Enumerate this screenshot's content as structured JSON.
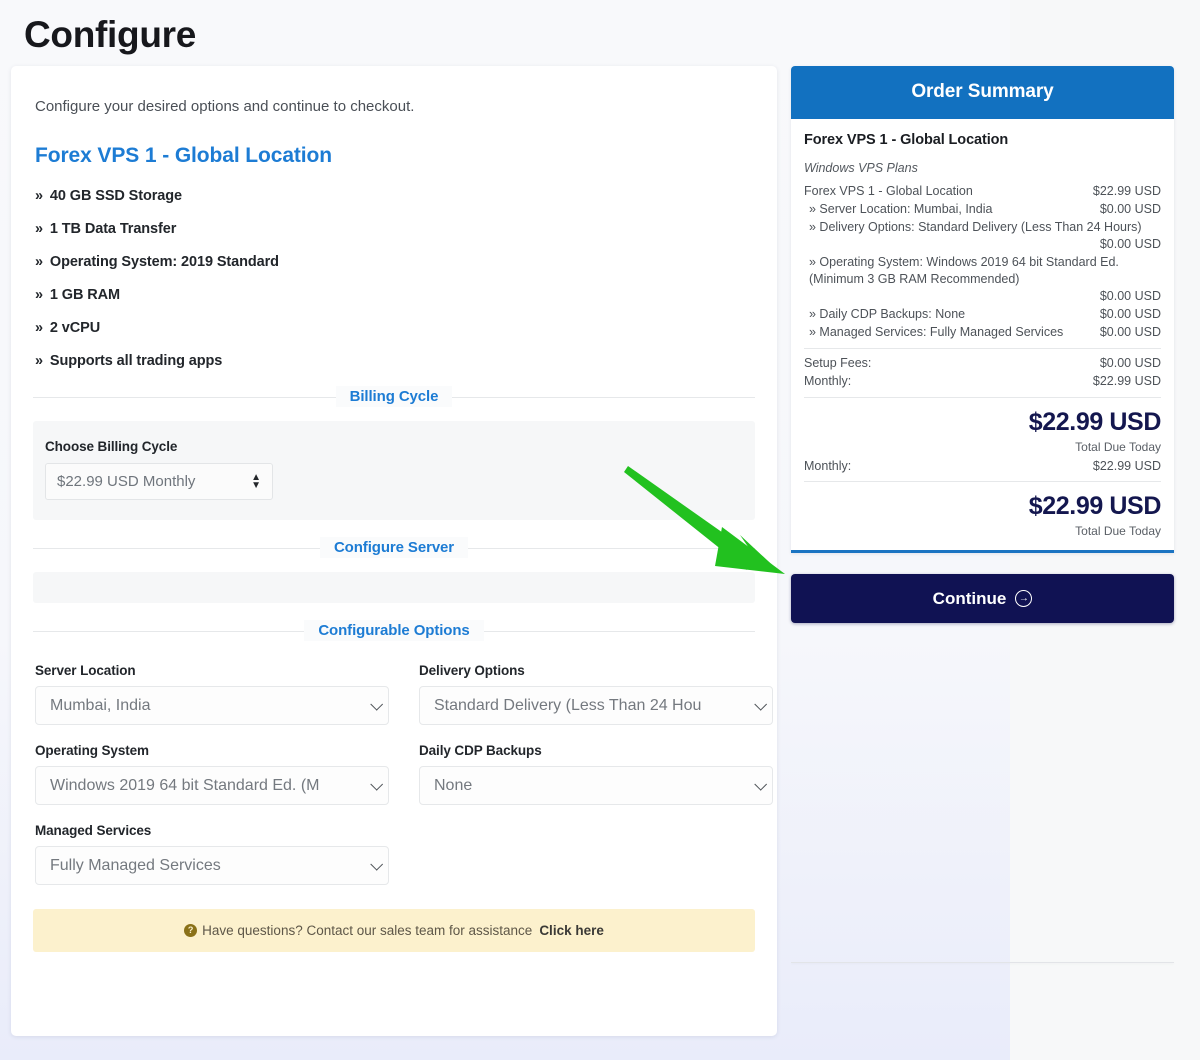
{
  "page": {
    "title": "Configure"
  },
  "main": {
    "intro": "Configure your desired options and continue to checkout.",
    "product_title": "Forex VPS 1 - Global Location",
    "features": [
      "40 GB SSD Storage",
      "1 TB Data Transfer",
      "Operating System: 2019 Standard",
      "1 GB RAM",
      "2 vCPU",
      "Supports all trading apps"
    ],
    "bullet_glyph": "»",
    "sections": {
      "billing_cycle": "Billing Cycle",
      "configure_server": "Configure Server",
      "configurable_options": "Configurable Options"
    },
    "billing": {
      "label": "Choose Billing Cycle",
      "value": "$22.99 USD Monthly"
    },
    "options": [
      {
        "label": "Server Location",
        "value": "Mumbai, India"
      },
      {
        "label": "Delivery Options",
        "value": "Standard Delivery (Less Than 24 Hou"
      },
      {
        "label": "Operating System",
        "value": "Windows 2019 64 bit Standard Ed. (M"
      },
      {
        "label": "Daily CDP Backups",
        "value": "None"
      },
      {
        "label": "Managed Services",
        "value": "Fully Managed Services"
      }
    ],
    "alert": {
      "icon": "?",
      "text": "Have questions? Contact our sales team for assistance",
      "link": "Click here"
    }
  },
  "summary": {
    "header": "Order Summary",
    "product": "Forex VPS 1 - Global Location",
    "group": "Windows VPS Plans",
    "lines": [
      {
        "label": "Forex VPS 1 - Global Location",
        "amount": "$22.99 USD",
        "indent": false,
        "wrapped": false
      },
      {
        "label": "» Server Location: Mumbai, India",
        "amount": "$0.00 USD",
        "indent": true,
        "wrapped": false
      },
      {
        "label": "» Delivery Options: Standard Delivery (Less Than 24 Hours)",
        "amount": "$0.00 USD",
        "indent": true,
        "wrapped": true
      },
      {
        "label": "» Operating System: Windows 2019 64 bit Standard Ed. (Minimum 3 GB RAM Recommended)",
        "amount": "$0.00 USD",
        "indent": true,
        "wrapped": true
      },
      {
        "label": "» Daily CDP Backups: None",
        "amount": "$0.00 USD",
        "indent": true,
        "wrapped": false
      },
      {
        "label": "» Managed Services: Fully Managed Services",
        "amount": "$0.00 USD",
        "indent": true,
        "wrapped": false
      }
    ],
    "fees": [
      {
        "label": "Setup Fees:",
        "amount": "$0.00 USD"
      },
      {
        "label": "Monthly:",
        "amount": "$22.99 USD"
      }
    ],
    "total_1": "$22.99 USD",
    "total_1_sub": "Total Due Today",
    "recurring": {
      "label": "Monthly:",
      "amount": "$22.99 USD"
    },
    "total_2": "$22.99 USD",
    "total_2_sub": "Total Due Today"
  },
  "actions": {
    "continue_label": "Continue",
    "continue_arrow": "→"
  },
  "colors": {
    "brand_blue": "#1271c0",
    "link_blue": "#1d7cd4",
    "navy": "#101253",
    "alert_bg": "#fcf1cd",
    "annotation_green": "#22c11f"
  }
}
